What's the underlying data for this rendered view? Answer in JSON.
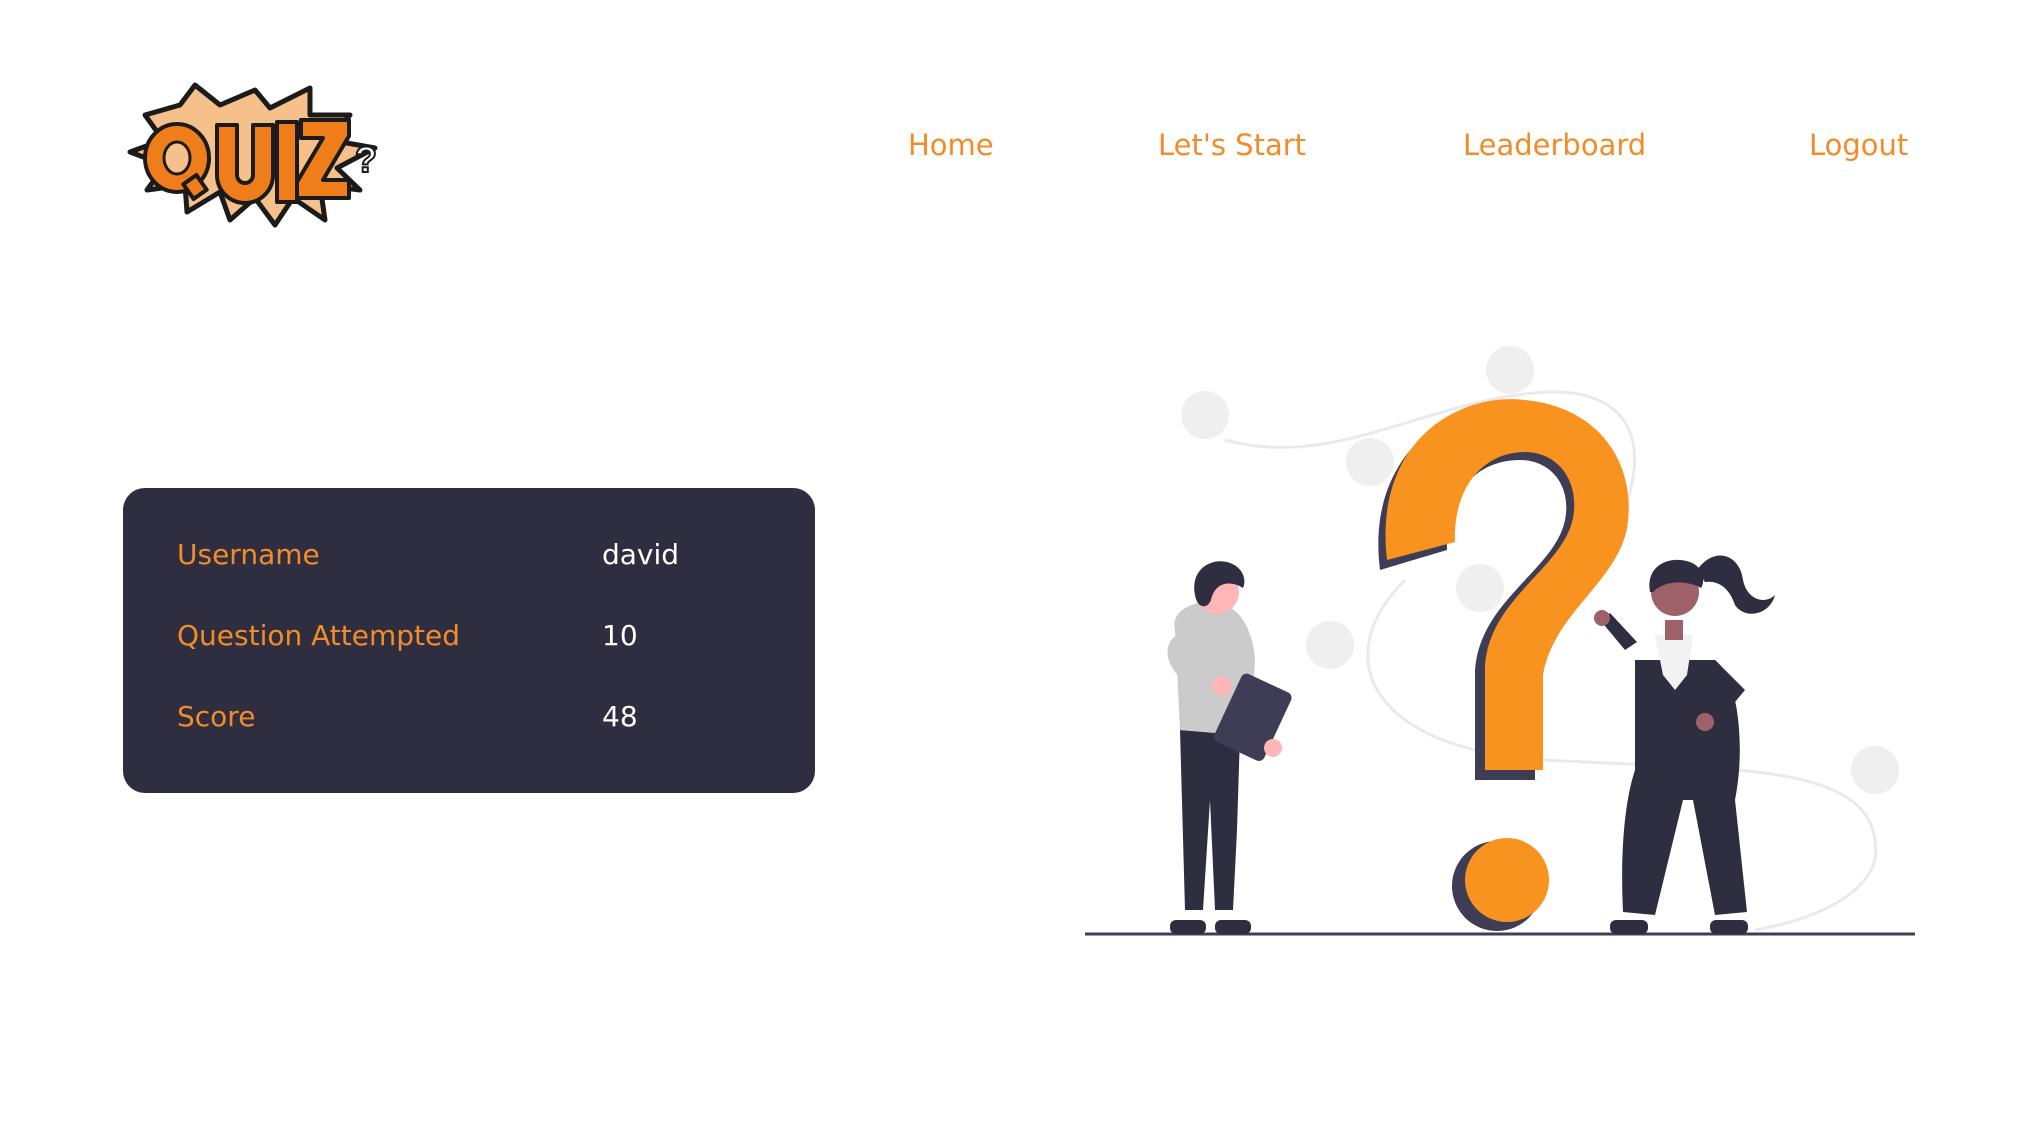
{
  "logo": {
    "text": "QUIZ",
    "icon": "quiz-logo-icon"
  },
  "nav": {
    "items": [
      {
        "label": "Home"
      },
      {
        "label": "Let's Start"
      },
      {
        "label": "Leaderboard"
      },
      {
        "label": "Logout"
      }
    ]
  },
  "stats": {
    "rows": [
      {
        "label": "Username",
        "value": "david"
      },
      {
        "label": "Question Attempted",
        "value": "10"
      },
      {
        "label": "Score",
        "value": "48"
      }
    ]
  },
  "colors": {
    "accent": "#F28C28",
    "card": "#2F2E41",
    "text_light": "#ffffff"
  },
  "illustration": {
    "icon": "question-mark-people-illustration"
  }
}
